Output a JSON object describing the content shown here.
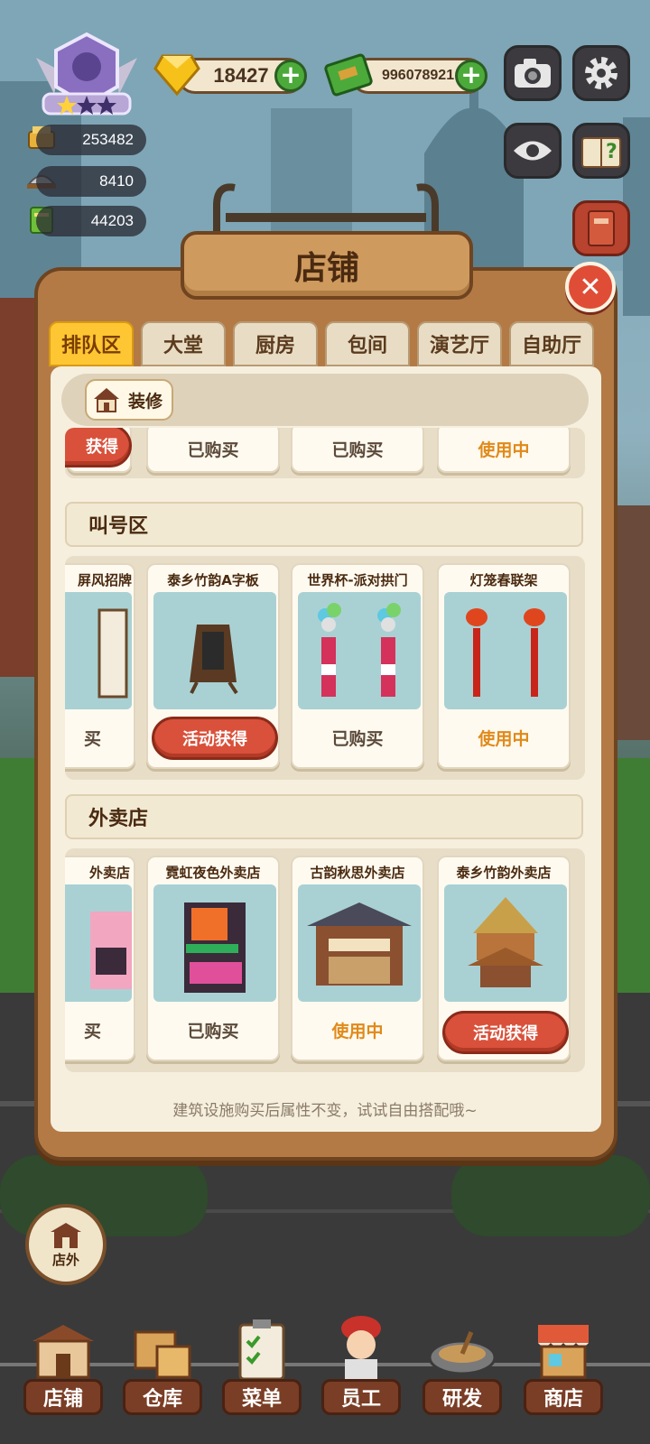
{
  "hud": {
    "gems": "18427",
    "cash": "996078921",
    "stats": [
      "253482",
      "8410",
      "44203"
    ]
  },
  "panel": {
    "title": "店铺",
    "close": "✕",
    "tabs": [
      "排队区",
      "大堂",
      "厨房",
      "包间",
      "演艺厅",
      "自助厅"
    ],
    "active_tab": "排队区",
    "decorate": "装修",
    "footer": "建筑设施购买后属性不变，试试自由搭配哦~"
  },
  "row0": {
    "items": [
      {
        "button": "获得"
      },
      {
        "status": "已购买"
      },
      {
        "status": "已购买"
      },
      {
        "status": "使用中"
      }
    ]
  },
  "section1": {
    "title": "叫号区",
    "items": [
      {
        "title": "屏风招牌",
        "status": "买"
      },
      {
        "title": "泰乡竹韵A字板",
        "button": "活动获得"
      },
      {
        "title": "世界杯-派对拱门",
        "status": "已购买"
      },
      {
        "title": "灯笼春联架",
        "status": "使用中"
      }
    ]
  },
  "section2": {
    "title": "外卖店",
    "items": [
      {
        "title": "外卖店",
        "status": "买"
      },
      {
        "title": "霓虹夜色外卖店",
        "status": "已购买"
      },
      {
        "title": "古韵秋思外卖店",
        "status": "使用中"
      },
      {
        "title": "泰乡竹韵外卖店",
        "button": "活动获得"
      }
    ]
  },
  "outside": "店外",
  "nav": [
    "店铺",
    "仓库",
    "菜单",
    "员工",
    "研发",
    "商店"
  ],
  "colors": {
    "accent": "#ffc633",
    "red": "#d9513b",
    "in_use": "#e08a1a"
  }
}
